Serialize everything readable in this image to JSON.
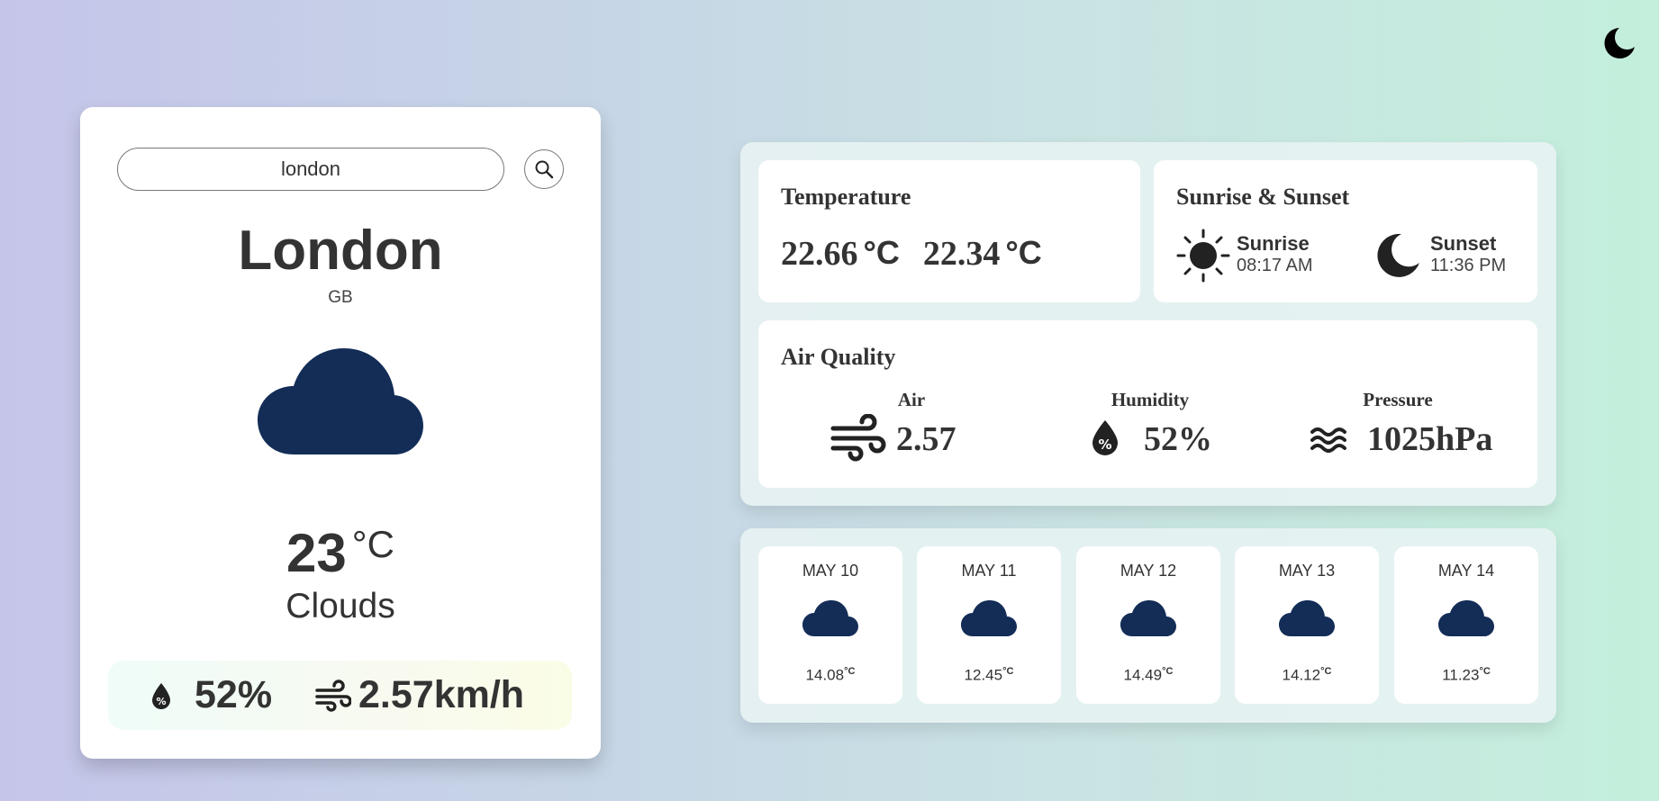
{
  "theme_toggle": {
    "icon": "moon-icon"
  },
  "search": {
    "value": "london",
    "placeholder": "Search city",
    "button_icon": "search-icon"
  },
  "location": {
    "city": "London",
    "country": "GB"
  },
  "current": {
    "temperature": "23",
    "unit": "°C",
    "condition": "Clouds",
    "icon": "cloud-icon",
    "humidity": "52%",
    "wind": "2.57km/h"
  },
  "temperature_card": {
    "title": "Temperature",
    "value1": "22.66",
    "value2": "22.34",
    "unit": "°C"
  },
  "sun_card": {
    "title": "Sunrise & Sunset",
    "sunrise_label": "Sunrise",
    "sunrise_time": "08:17 AM",
    "sunset_label": "Sunset",
    "sunset_time": "11:36 PM"
  },
  "air_quality": {
    "title": "Air Quality",
    "air_label": "Air",
    "air_value": "2.57",
    "humidity_label": "Humidity",
    "humidity_value": "52%",
    "pressure_label": "Pressure",
    "pressure_value": "1025hPa"
  },
  "forecast": [
    {
      "date": "MAY 10",
      "temp": "14.08",
      "unit": "°C",
      "icon": "cloud-icon"
    },
    {
      "date": "MAY 11",
      "temp": "12.45",
      "unit": "°C",
      "icon": "cloud-icon"
    },
    {
      "date": "MAY 12",
      "temp": "14.49",
      "unit": "°C",
      "icon": "cloud-icon"
    },
    {
      "date": "MAY 13",
      "temp": "14.12",
      "unit": "°C",
      "icon": "cloud-icon"
    },
    {
      "date": "MAY 14",
      "temp": "11.23",
      "unit": "°C",
      "icon": "cloud-icon"
    }
  ],
  "colors": {
    "cloud": "#132d57",
    "text": "#333333",
    "card": "#ffffff"
  }
}
